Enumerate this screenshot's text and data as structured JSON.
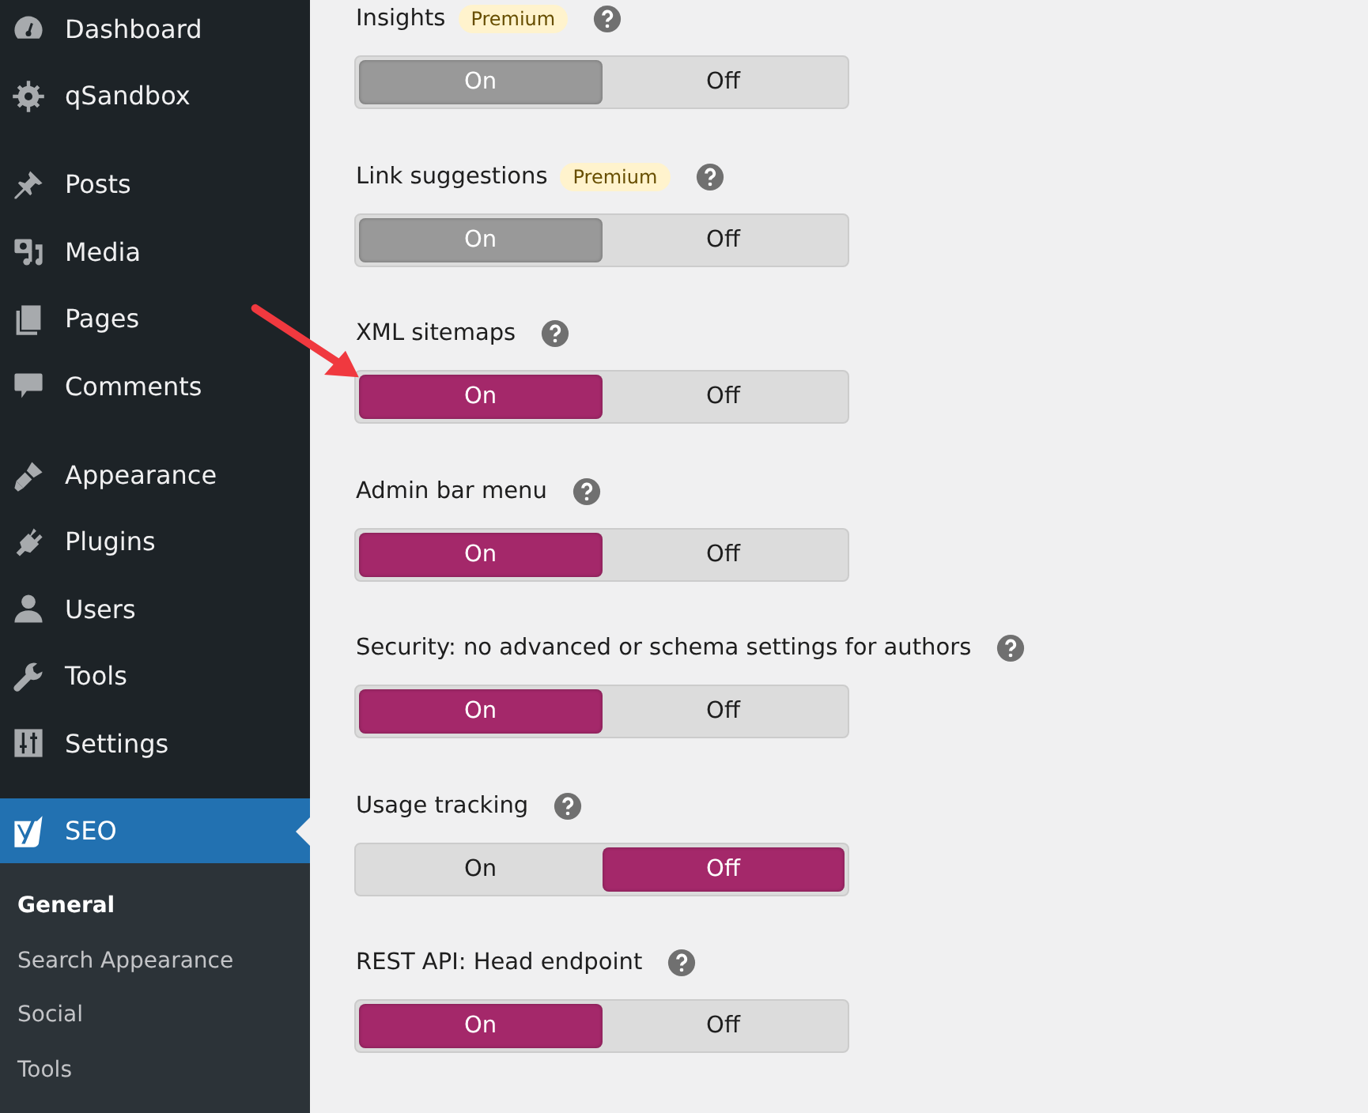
{
  "sidebar": {
    "groups": [
      {
        "items": [
          {
            "label": "Dashboard",
            "selected": false
          },
          {
            "label": "qSandbox",
            "selected": false
          }
        ]
      },
      {
        "items": [
          {
            "label": "Posts",
            "selected": false
          },
          {
            "label": "Media",
            "selected": false
          },
          {
            "label": "Pages",
            "selected": false
          },
          {
            "label": "Comments",
            "selected": false
          }
        ]
      },
      {
        "items": [
          {
            "label": "Appearance",
            "selected": false
          },
          {
            "label": "Plugins",
            "selected": false
          },
          {
            "label": "Users",
            "selected": false
          },
          {
            "label": "Tools",
            "selected": false
          },
          {
            "label": "Settings",
            "selected": false
          }
        ]
      },
      {
        "items": [
          {
            "label": "SEO",
            "selected": true
          }
        ]
      }
    ],
    "submenu": [
      {
        "label": "General",
        "selected": true
      },
      {
        "label": "Search Appearance",
        "selected": false
      },
      {
        "label": "Social",
        "selected": false
      },
      {
        "label": "Tools",
        "selected": false
      }
    ]
  },
  "settings": [
    {
      "label": "Insights",
      "badge": "Premium",
      "disabled": true,
      "options": [
        {
          "label": "On",
          "selected": true
        },
        {
          "label": "Off",
          "selected": false
        }
      ]
    },
    {
      "label": "Link suggestions",
      "badge": "Premium",
      "disabled": true,
      "options": [
        {
          "label": "On",
          "selected": true
        },
        {
          "label": "Off",
          "selected": false
        }
      ]
    },
    {
      "label": "XML sitemaps",
      "disabled": false,
      "options": [
        {
          "label": "On",
          "selected": true
        },
        {
          "label": "Off",
          "selected": false
        }
      ]
    },
    {
      "label": "Admin bar menu",
      "disabled": false,
      "options": [
        {
          "label": "On",
          "selected": true
        },
        {
          "label": "Off",
          "selected": false
        }
      ]
    },
    {
      "label": "Security: no advanced or schema settings for authors",
      "disabled": false,
      "options": [
        {
          "label": "On",
          "selected": true
        },
        {
          "label": "Off",
          "selected": false
        }
      ]
    },
    {
      "label": "Usage tracking",
      "disabled": false,
      "options": [
        {
          "label": "On",
          "selected": false
        },
        {
          "label": "Off",
          "selected": true
        }
      ]
    },
    {
      "label": "REST API: Head endpoint",
      "disabled": false,
      "options": [
        {
          "label": "On",
          "selected": true
        },
        {
          "label": "Off",
          "selected": false
        }
      ]
    }
  ]
}
